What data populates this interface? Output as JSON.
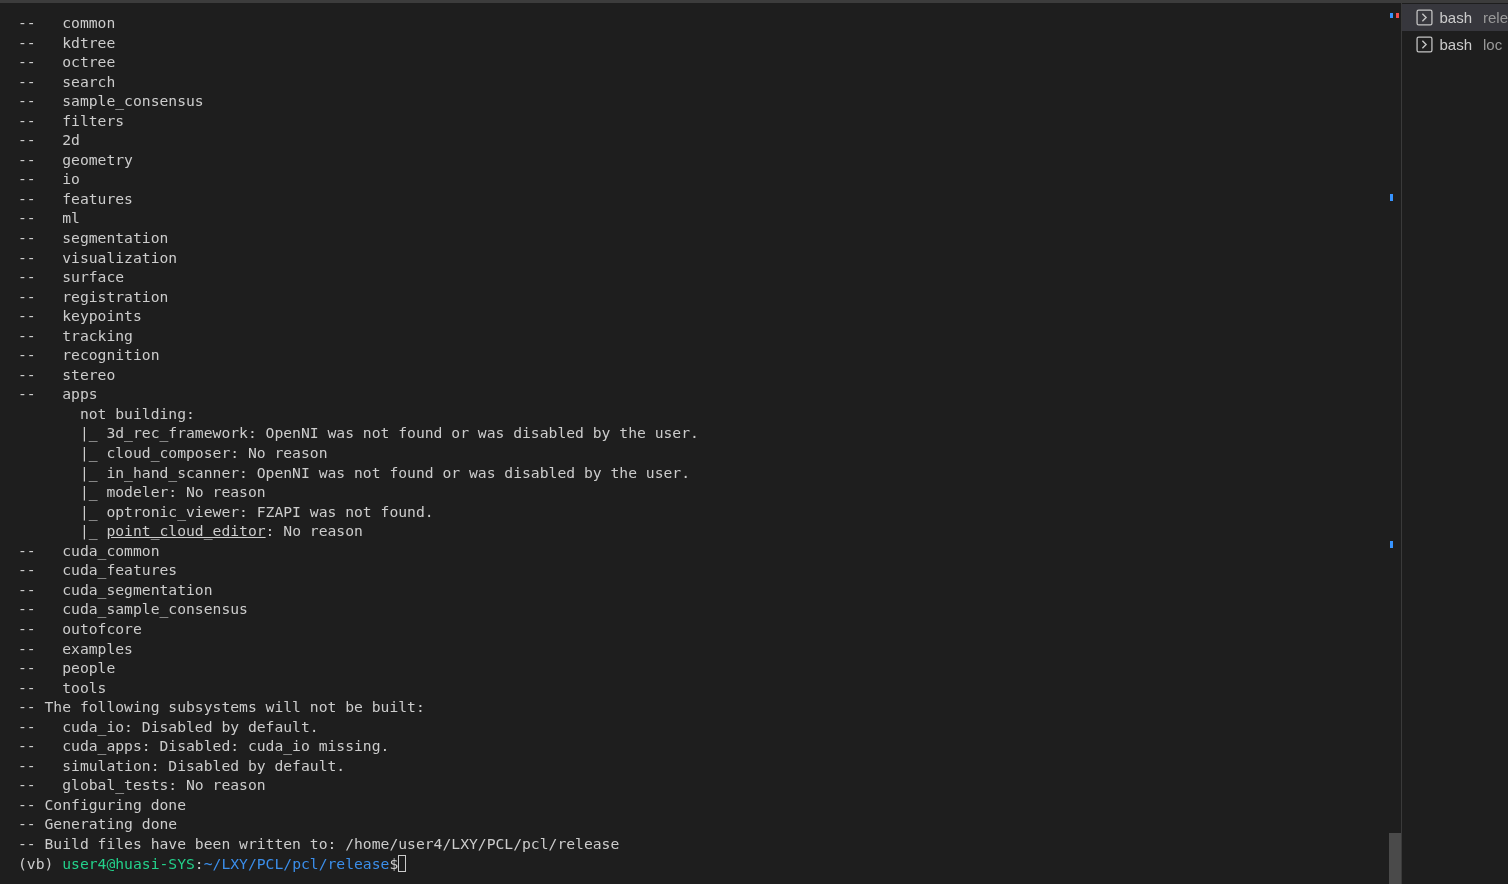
{
  "terminal": {
    "lines": [
      {
        "text": "--   common"
      },
      {
        "text": "--   kdtree"
      },
      {
        "text": "--   octree"
      },
      {
        "text": "--   search"
      },
      {
        "text": "--   sample_consensus"
      },
      {
        "text": "--   filters"
      },
      {
        "text": "--   2d"
      },
      {
        "text": "--   geometry"
      },
      {
        "text": "--   io"
      },
      {
        "text": "--   features"
      },
      {
        "text": "--   ml"
      },
      {
        "text": "--   segmentation"
      },
      {
        "text": "--   visualization"
      },
      {
        "text": "--   surface"
      },
      {
        "text": "--   registration"
      },
      {
        "text": "--   keypoints"
      },
      {
        "text": "--   tracking"
      },
      {
        "text": "--   recognition"
      },
      {
        "text": "--   stereo"
      },
      {
        "text": "--   apps"
      },
      {
        "text": "       not building:"
      },
      {
        "text": "       |_ 3d_rec_framework: OpenNI was not found or was disabled by the user."
      },
      {
        "text": "       |_ cloud_composer: No reason"
      },
      {
        "text": "       |_ in_hand_scanner: OpenNI was not found or was disabled by the user."
      },
      {
        "text": "       |_ modeler: No reason"
      },
      {
        "text": "       |_ optronic_viewer: FZAPI was not found."
      },
      {
        "text": "       |_ ",
        "link": "point_cloud_editor",
        "rest": ": No reason"
      },
      {
        "text": "--   cuda_common"
      },
      {
        "text": "--   cuda_features"
      },
      {
        "text": "--   cuda_segmentation"
      },
      {
        "text": "--   cuda_sample_consensus"
      },
      {
        "text": "--   outofcore"
      },
      {
        "text": "--   examples"
      },
      {
        "text": "--   people"
      },
      {
        "text": "--   tools"
      },
      {
        "text": "-- The following subsystems will not be built:"
      },
      {
        "text": "--   cuda_io: Disabled by default."
      },
      {
        "text": "--   cuda_apps: Disabled: cuda_io missing."
      },
      {
        "text": "--   simulation: Disabled by default."
      },
      {
        "text": "--   global_tests: No reason"
      },
      {
        "text": "-- Configuring done"
      },
      {
        "text": "-- Generating done"
      },
      {
        "text": "-- Build files have been written to: /home/user4/LXY/PCL/pcl/release"
      }
    ],
    "prompt": {
      "env": "(vb) ",
      "user_host": "user4@huasi-SYS",
      "sep": ":",
      "path": "~/LXY/PCL/pcl/release",
      "symbol": "$"
    }
  },
  "terminal_tabs": [
    {
      "shell": "bash",
      "label": "rele",
      "selected": true
    },
    {
      "shell": "bash",
      "label": "loc",
      "selected": false
    }
  ]
}
